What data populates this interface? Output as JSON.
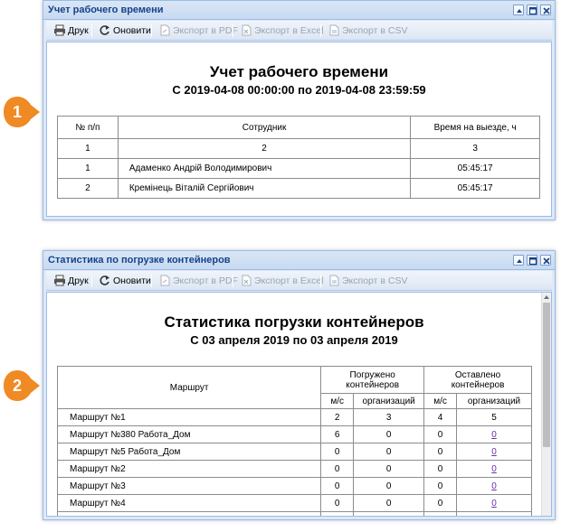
{
  "markers": [
    "1",
    "2"
  ],
  "toolbar": {
    "print": "Друк",
    "refresh": "Оновити",
    "pdf": "Экспорт в PDF",
    "excel": "Экспорт в Excel",
    "csv": "Экспорт в CSV"
  },
  "window1": {
    "title": "Учет рабочего времени",
    "report_title": "Учет рабочего времени",
    "report_subtitle": "С 2019-04-08 00:00:00 по 2019-04-08 23:59:59",
    "headers": [
      "№ п/п",
      "Сотрудник",
      "Время на выезде, ч"
    ],
    "numbering": [
      "1",
      "2",
      "3"
    ],
    "rows": [
      [
        "1",
        "Адаменко Андрій Володимирович",
        "05:45:17"
      ],
      [
        "2",
        "Кремінець Віталій Сергійович",
        "05:45:17"
      ]
    ]
  },
  "window2": {
    "title": "Статистика по погрузке контейнеров",
    "report_title": "Статистика погрузки контейнеров",
    "report_subtitle": "С 03 апреля 2019 по 03 апреля 2019",
    "headers": {
      "route": "Маршрут",
      "loaded": "Погружено контейнеров",
      "left": "Оставлено контейнеров",
      "sub_ms": "м/с",
      "sub_org": "организаций"
    },
    "rows": [
      [
        "Маршрут №1",
        "2",
        "3",
        "4",
        "5"
      ],
      [
        "Маршрут №380 Работа_Дом",
        "6",
        "0",
        "0",
        "0"
      ],
      [
        "Маршрут №5 Работа_Дом",
        "0",
        "0",
        "0",
        "0"
      ],
      [
        "Маршрут №2",
        "0",
        "0",
        "0",
        "0"
      ],
      [
        "Маршрут №3",
        "0",
        "0",
        "0",
        "0"
      ],
      [
        "Маршрут №4",
        "0",
        "0",
        "0",
        "0"
      ]
    ]
  },
  "colors": {
    "marker": "#f08a24",
    "title_text": "#15428b",
    "window_border": "#99bbe8"
  }
}
